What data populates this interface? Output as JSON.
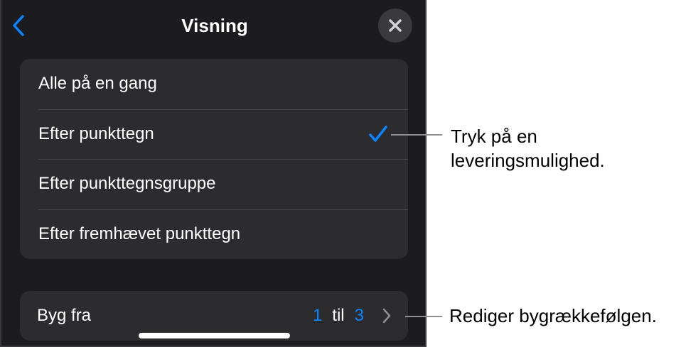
{
  "header": {
    "title": "Visning",
    "back_icon": "chevron-left-icon",
    "close_icon": "close-icon"
  },
  "options": [
    {
      "label": "Alle på en gang",
      "selected": false
    },
    {
      "label": "Efter punkttegn",
      "selected": true
    },
    {
      "label": "Efter punkttegnsgruppe",
      "selected": false
    },
    {
      "label": "Efter fremhævet punkttegn",
      "selected": false
    }
  ],
  "build_from": {
    "label": "Byg fra",
    "from": "1",
    "separator": "til",
    "to": "3",
    "chevron_icon": "chevron-right-icon"
  },
  "callouts": {
    "delivery": "Tryk på en leveringsmulighed.",
    "build_order": "Rediger bygrækkefølgen."
  },
  "colors": {
    "background": "#1c1c1e",
    "group": "#2c2c2e",
    "accent": "#0a84ff",
    "text": "#ffffff"
  }
}
